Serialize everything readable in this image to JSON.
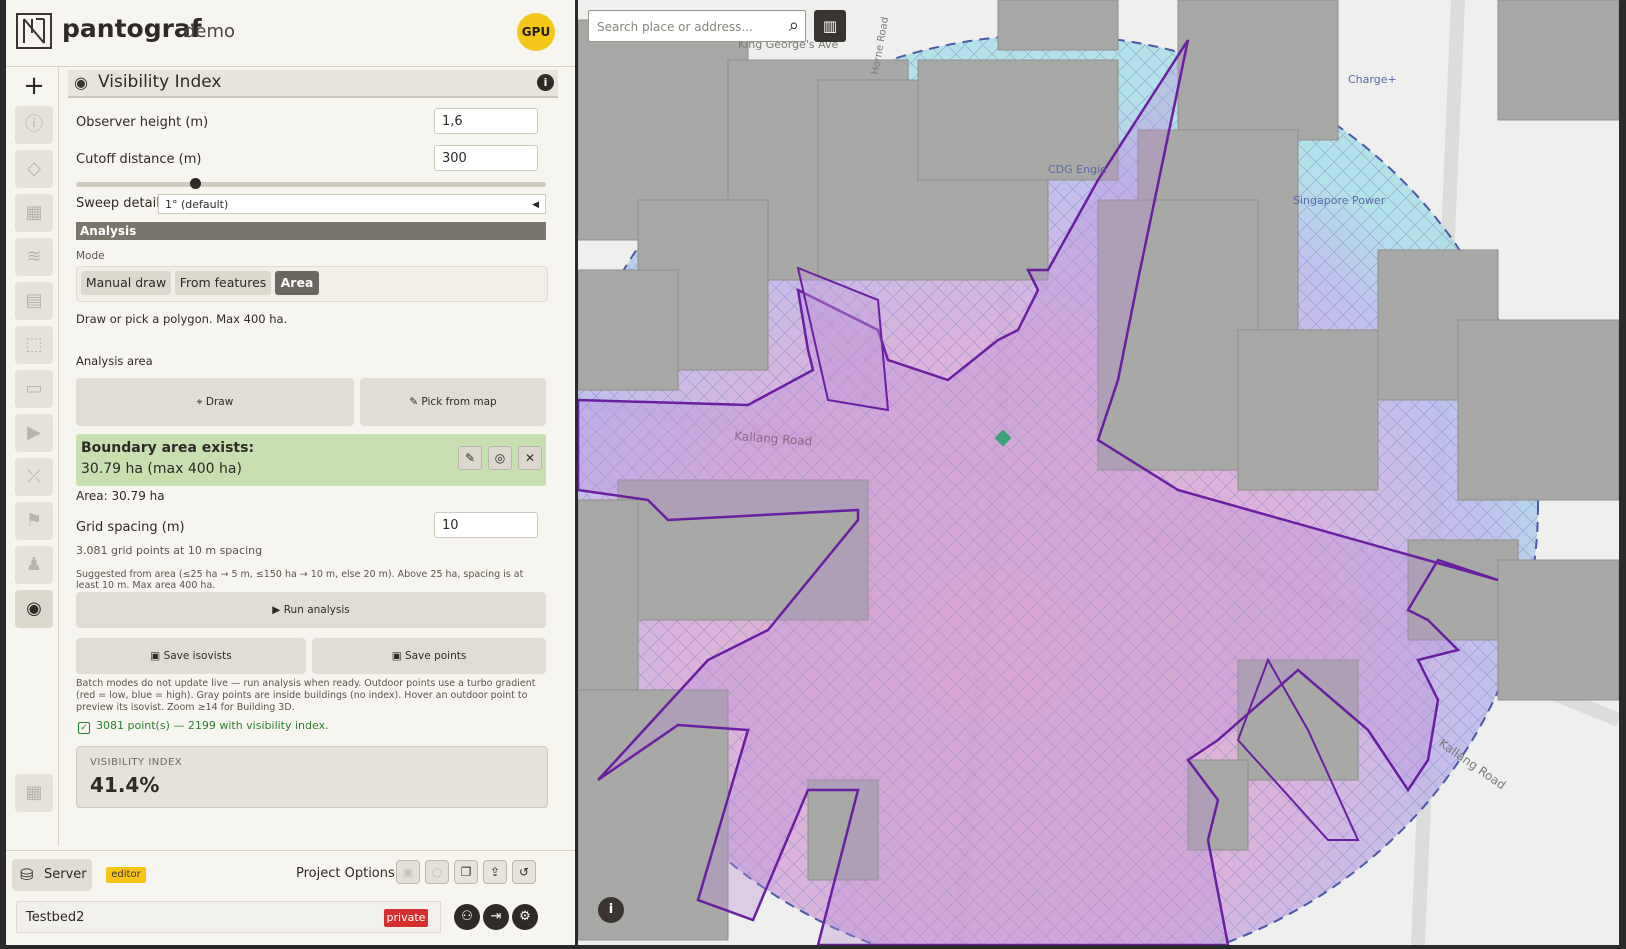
{
  "app": {
    "brand": "pantograf",
    "brand_sub": "demo",
    "gpu_badge": "GPU"
  },
  "panel": {
    "title": "Visibility Index",
    "info": "i",
    "observer_height": {
      "label": "Observer height (m)",
      "value": "1,6"
    },
    "cutoff_distance": {
      "label": "Cutoff distance (m)",
      "value": "300",
      "slider_fraction": 0.23
    },
    "sweep_detail": {
      "label": "Sweep detail",
      "value": "1° (default)"
    },
    "analysis": {
      "header": "Analysis",
      "mode_label": "Mode",
      "modes": [
        "Manual draw",
        "From features",
        "Area"
      ],
      "active_mode": "Area",
      "hint": "Draw or pick a polygon. Max 400 ha.",
      "area_label": "Analysis area",
      "draw_label": "Draw",
      "pick_label": "Pick from map",
      "boundary_title": "Boundary area exists:",
      "boundary_value": "30.79 ha (max 400 ha)",
      "area_text": "Area: 30.79 ha",
      "grid_spacing_label": "Grid spacing (m)",
      "grid_spacing_value": "10",
      "grid_points": "3.081 grid points at 10 m spacing",
      "suggestion": "Suggested from area (≤25 ha → 5 m, ≤150 ha → 10 m, else 20 m). Above 25 ha, spacing is at least 10 m. Max area 400 ha.",
      "run_label": "Run analysis",
      "save_isovists": "Save isovists",
      "save_points": "Save points",
      "batch_note": "Batch modes do not update live — run analysis when ready. Outdoor points use a turbo gradient (red = low, blue = high). Gray points are inside buildings (no index). Hover an outdoor point to preview its isovist. Zoom ≥14 for Building 3D.",
      "result_line": "3081 point(s) — 2199 with visibility index.",
      "vi_caption": "VISIBILITY INDEX",
      "vi_value": "41.4%"
    }
  },
  "footer": {
    "server_label": "Server",
    "editor_badge": "editor",
    "project_options_label": "Project Options:",
    "project_name": "Testbed2",
    "private_badge": "private"
  },
  "map": {
    "search_placeholder": "Search place or address...",
    "info": "i",
    "labels": [
      "King George's Ave",
      "Horne Road",
      "Charge+",
      "CDG Engie",
      "Singapore Power",
      "Kallang Road",
      "Kallang Road"
    ],
    "colors": {
      "isovist_stroke": "#6a1fa0",
      "isovist_fill": "#c49ad8",
      "boundary_dash": "#4a5aa8"
    }
  }
}
